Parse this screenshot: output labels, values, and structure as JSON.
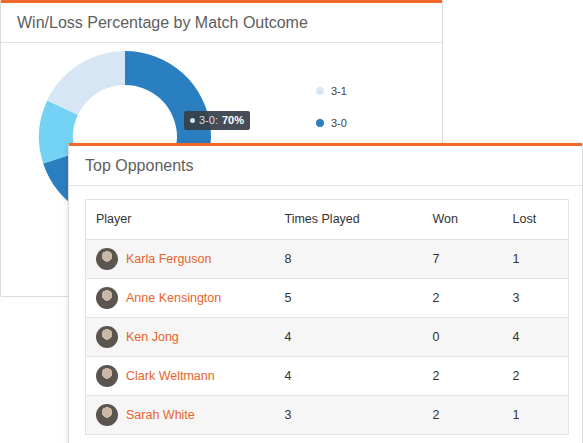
{
  "back_card": {
    "title": "Win/Loss Percentage by Match Outcome",
    "chart": {
      "segments": [
        {
          "value": 70,
          "color": "#2a7fc1"
        },
        {
          "value": 12,
          "color": "#74d3f4"
        },
        {
          "value": 18,
          "color": "#d6e6f5"
        }
      ],
      "legend": [
        {
          "label": "3-1",
          "color": "#d6e6f5"
        },
        {
          "label": "3-0",
          "color": "#2a7fc1"
        }
      ],
      "tooltip": {
        "label": "3-0:",
        "value": "70%"
      }
    }
  },
  "front_card": {
    "title": "Top Opponents",
    "table": {
      "columns": [
        "Player",
        "Times Played",
        "Won",
        "Lost"
      ],
      "rows": [
        [
          "Karla Ferguson",
          "8",
          "7",
          "1"
        ],
        [
          "Anne Kensington",
          "5",
          "2",
          "3"
        ],
        [
          "Ken Jong",
          "4",
          "0",
          "4"
        ],
        [
          "Clark Weltmann",
          "4",
          "2",
          "2"
        ],
        [
          "Sarah White",
          "3",
          "2",
          "1"
        ]
      ]
    }
  }
}
